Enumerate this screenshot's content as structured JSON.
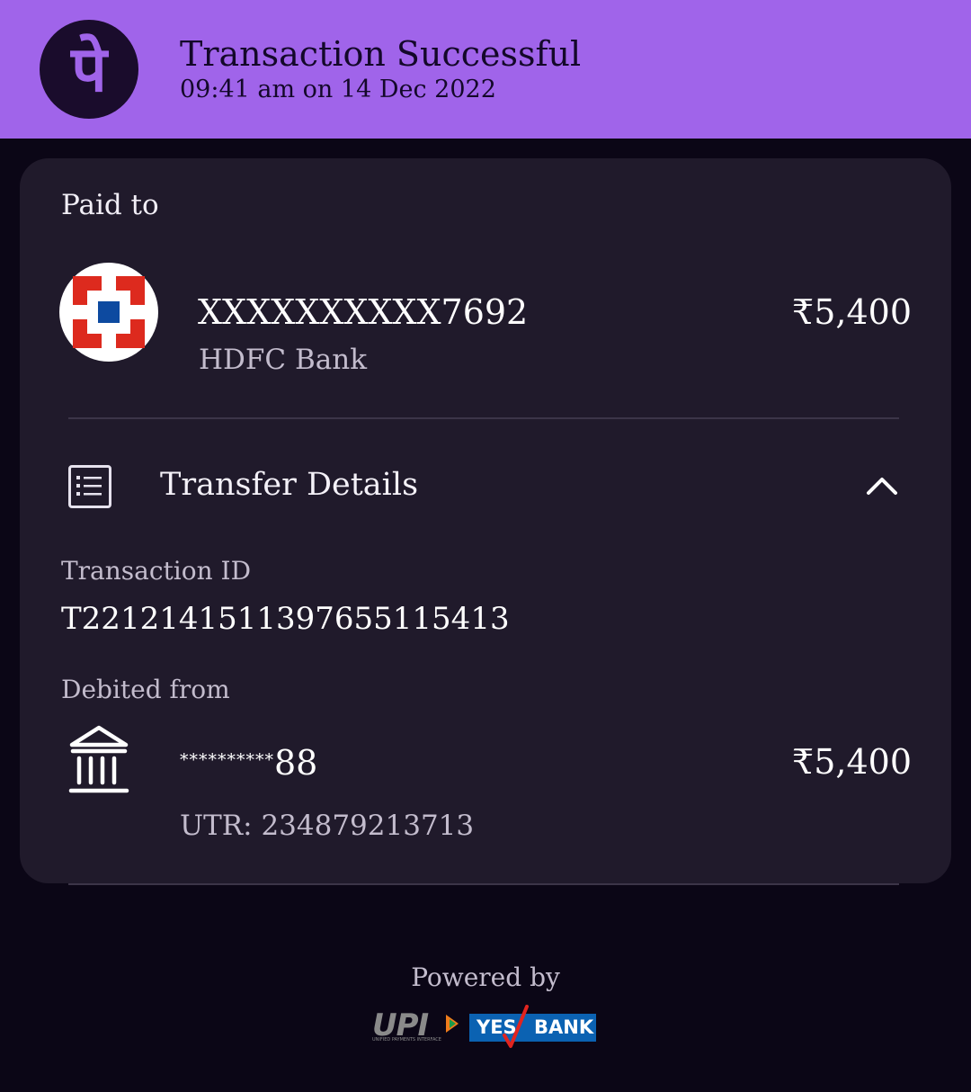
{
  "header": {
    "logo_glyph": "पे",
    "title": "Transaction Successful",
    "subtitle": "09:41 am on 14 Dec 2022",
    "background": "#a064ea"
  },
  "paid_to": {
    "label": "Paid to",
    "account": "XXXXXXXXXX7692",
    "bank": "HDFC Bank",
    "amount": "₹5,400",
    "logo_icon": "hdfc-bank-logo"
  },
  "transfer": {
    "title": "Transfer Details",
    "icon": "document-list-icon",
    "toggle_icon": "chevron-up-icon",
    "transaction_label": "Transaction ID",
    "transaction_id": "T2212141511397655115413",
    "debited_label": "Debited from",
    "debited_masked": "**********",
    "debited_suffix": "88",
    "debited_amount": "₹5,400",
    "utr": "UTR: 234879213713",
    "bank_icon": "bank-building-icon"
  },
  "footer": {
    "powered_by": "Powered by",
    "upi_text": "UPI",
    "upi_subtext": "UNIFIED PAYMENTS INTERFACE",
    "yes_left": "YES",
    "yes_right": "BANK"
  }
}
